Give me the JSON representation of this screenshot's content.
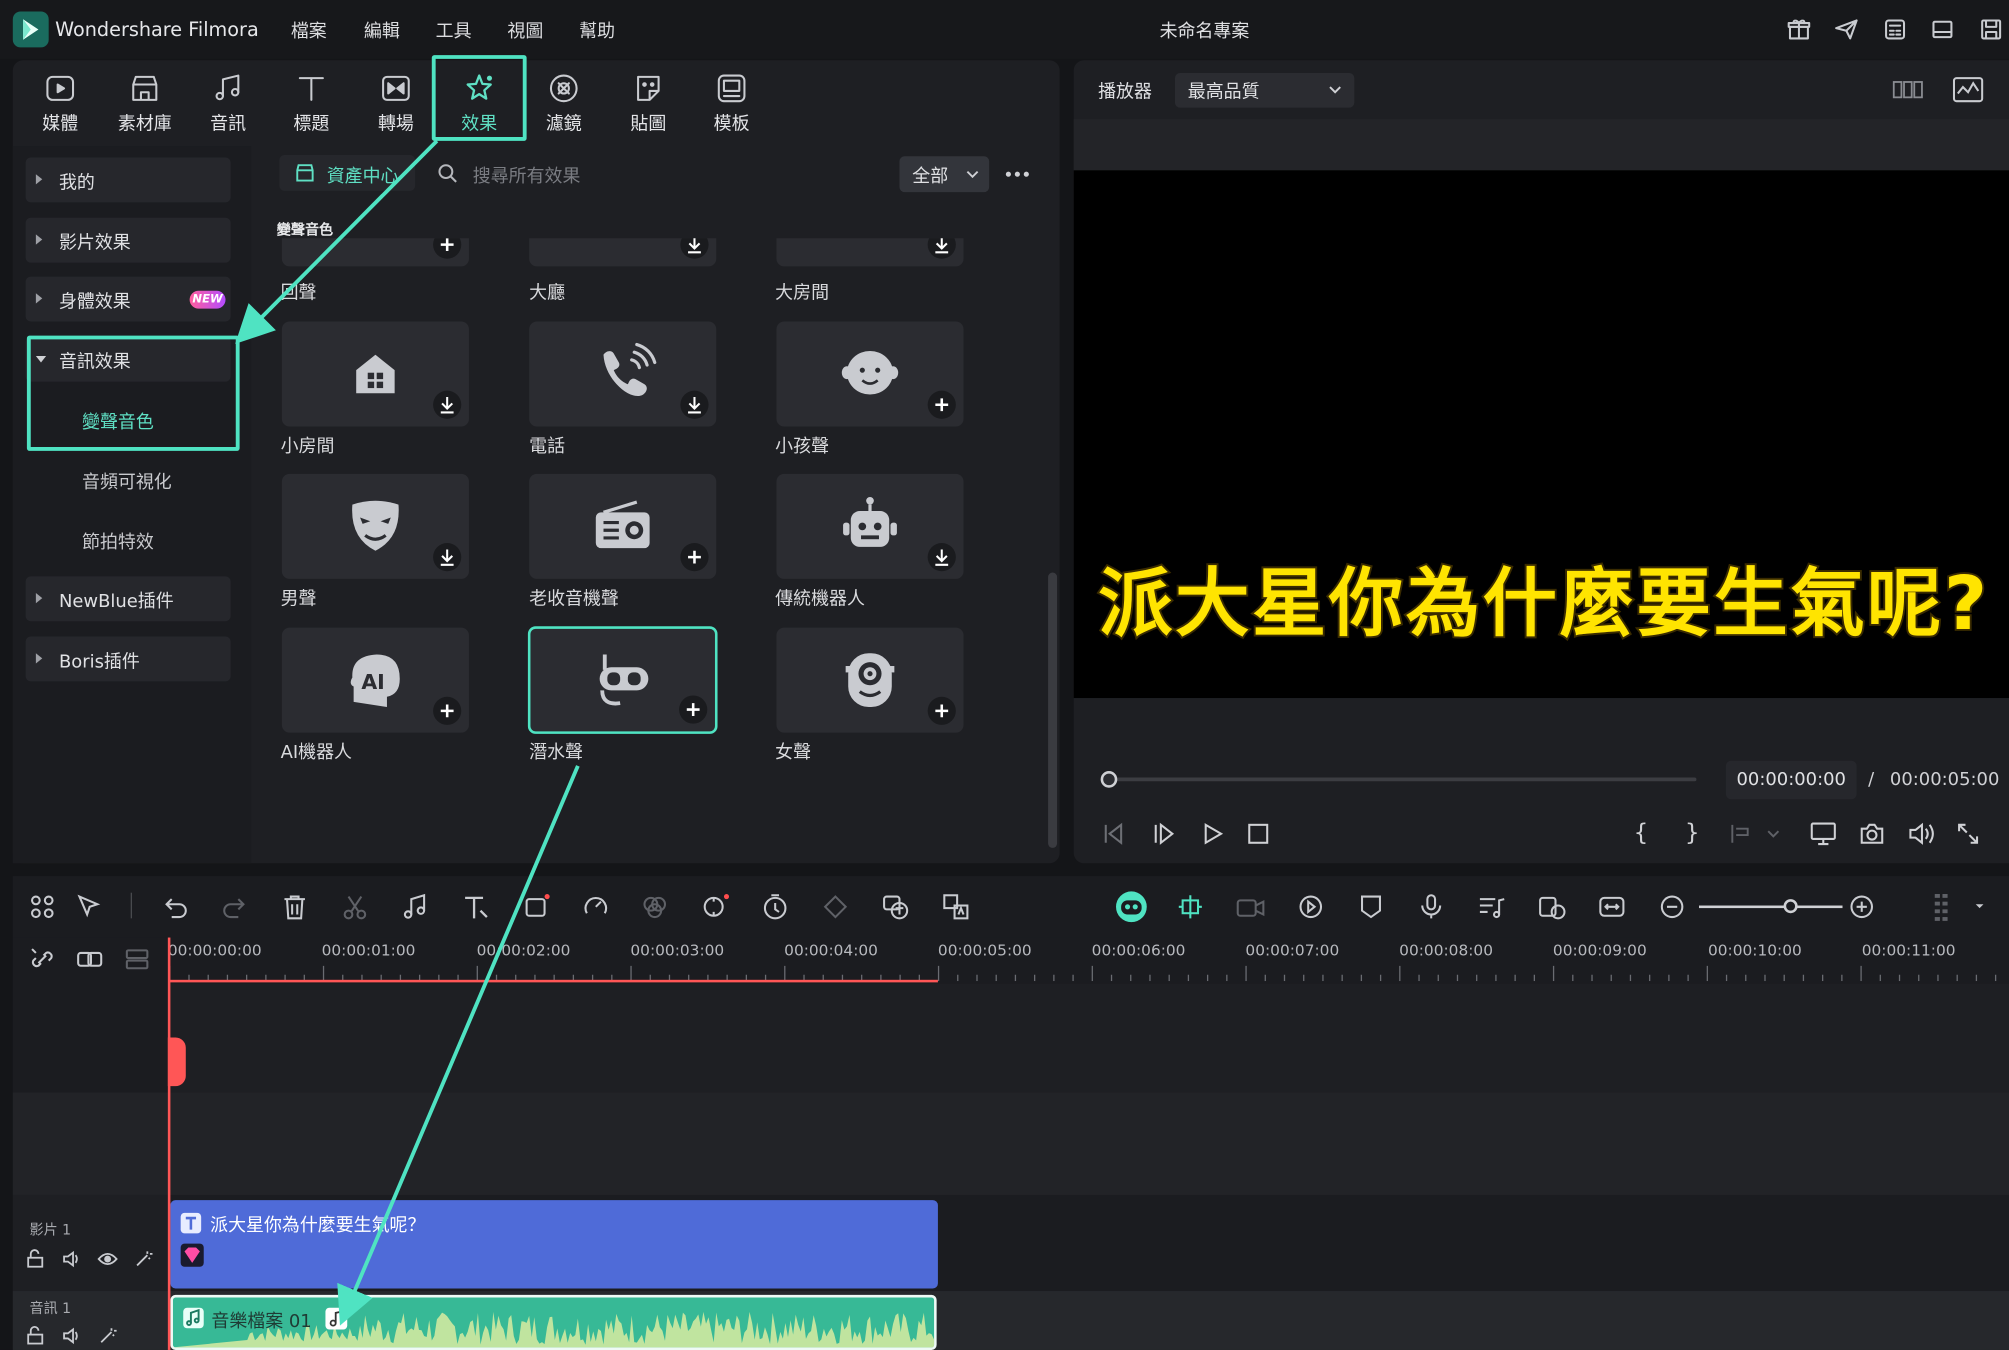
{
  "app": {
    "name": "Wondershare Filmora",
    "project": "未命名專案"
  },
  "menu": [
    "檔案",
    "編輯",
    "工具",
    "視圖",
    "幫助"
  ],
  "tabs": [
    {
      "label": "媒體",
      "icon": "media-icon"
    },
    {
      "label": "素材庫",
      "icon": "stock-icon"
    },
    {
      "label": "音訊",
      "icon": "audio-note-icon"
    },
    {
      "label": "標題",
      "icon": "title-t-icon"
    },
    {
      "label": "轉場",
      "icon": "transition-icon"
    },
    {
      "label": "效果",
      "icon": "effects-star-icon",
      "active": true
    },
    {
      "label": "濾鏡",
      "icon": "filter-icon"
    },
    {
      "label": "貼圖",
      "icon": "sticker-icon"
    },
    {
      "label": "模板",
      "icon": "template-icon"
    }
  ],
  "sidebar": {
    "items": [
      "我的",
      "影片效果",
      "身體效果",
      "音訊效果",
      "NewBlue插件",
      "Boris插件"
    ],
    "new_badge": "NEW",
    "subitems": [
      "變聲音色",
      "音頻可視化",
      "節拍特效"
    ]
  },
  "library": {
    "asset_center": "資產中心",
    "search_placeholder": "搜尋所有效果",
    "filter": "全部",
    "section": "變聲音色",
    "cards": [
      {
        "label": "回聲",
        "icon": "echo-icon"
      },
      {
        "label": "大廳",
        "icon": "hall-icon"
      },
      {
        "label": "大房間",
        "icon": "big-room-icon"
      },
      {
        "label": "小房間",
        "icon": "small-room-icon"
      },
      {
        "label": "電話",
        "icon": "phone-icon"
      },
      {
        "label": "小孩聲",
        "icon": "child-face-icon"
      },
      {
        "label": "男聲",
        "icon": "mask-icon"
      },
      {
        "label": "老收音機聲",
        "icon": "radio-icon"
      },
      {
        "label": "傳統機器人",
        "icon": "robot-icon"
      },
      {
        "label": "AI機器人",
        "icon": "ai-head-icon"
      },
      {
        "label": "潛水聲",
        "icon": "diving-mask-icon",
        "selected": true
      },
      {
        "label": "女聲",
        "icon": "minion-icon"
      }
    ]
  },
  "player": {
    "label": "播放器",
    "quality": "最高品質",
    "caption": "派大星你為什麼要生氣呢?",
    "current_time": "00:00:00:00",
    "separator": "/",
    "duration": "00:00:05:00"
  },
  "timeline": {
    "ruler": [
      "00:00:00:00",
      "00:00:01:00",
      "00:00:02:00",
      "00:00:03:00",
      "00:00:04:00",
      "00:00:05:00",
      "00:00:06:00",
      "00:00:07:00",
      "00:00:08:00",
      "00:00:09:00",
      "00:00:10:00",
      "00:00:11:00"
    ],
    "video_track": "影片 1",
    "audio_track": "音訊 1",
    "video_clip": "派大星你為什麼要生氣呢？",
    "audio_clip": "音樂檔案 01"
  },
  "colors": {
    "accent": "#4fe3c2",
    "clip_video": "#4f6bd8",
    "clip_audio": "#37b996",
    "caption": "#ffe400",
    "playhead": "#ff5656"
  }
}
